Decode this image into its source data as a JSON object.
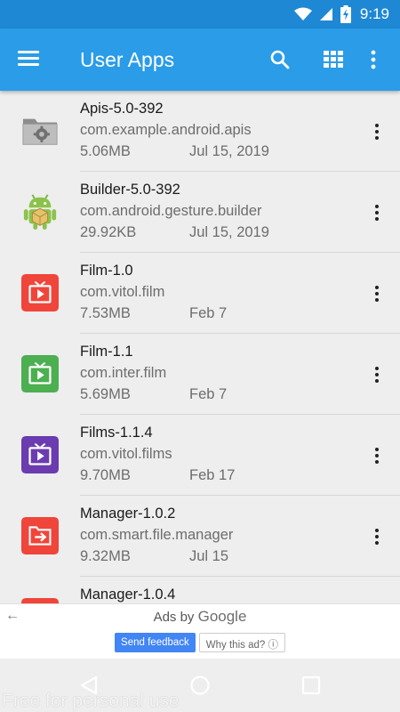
{
  "status_bar": {
    "time": "9:19",
    "icons": [
      "wifi-icon",
      "cellular-signal-icon",
      "battery-charging-icon"
    ]
  },
  "app_bar": {
    "title": "User Apps",
    "icons": [
      "menu-icon",
      "search-icon",
      "grid-view-icon",
      "more-vert-icon"
    ]
  },
  "apps": [
    {
      "name": "Apis-5.0-392",
      "package": "com.example.android.apis",
      "size": "5.06MB",
      "date": "Jul 15, 2019",
      "icon": "folder-gear-icon"
    },
    {
      "name": "Builder-5.0-392",
      "package": "com.android.gesture.builder",
      "size": "29.92KB",
      "date": "Jul 15, 2019",
      "icon": "android-robot-icon"
    },
    {
      "name": "Film-1.0",
      "package": "com.vitol.film",
      "size": "7.53MB",
      "date": "Feb 7",
      "icon": "tv-play-icon",
      "color": "#f0453a"
    },
    {
      "name": "Film-1.1",
      "package": "com.inter.film",
      "size": "5.69MB",
      "date": "Feb 7",
      "icon": "tv-play-icon",
      "color": "#4caf50"
    },
    {
      "name": "Films-1.1.4",
      "package": "com.vitol.films",
      "size": "9.70MB",
      "date": "Feb 17",
      "icon": "tv-play-icon",
      "color": "#6a3cb0"
    },
    {
      "name": "Manager-1.0.2",
      "package": "com.smart.file.manager",
      "size": "9.32MB",
      "date": "Jul 15",
      "icon": "file-transfer-icon",
      "color": "#f0453a"
    },
    {
      "name": "Manager-1.0.4",
      "package": "",
      "size": "",
      "date": "",
      "icon": "file-transfer-icon",
      "color": "#f0453a"
    }
  ],
  "ad": {
    "ads_by": "Ads by",
    "brand": "Google",
    "feedback_label": "Send feedback",
    "why_label": "Why this ad? ⓘ"
  },
  "nav": {
    "buttons": [
      "back-icon",
      "home-icon",
      "recents-icon"
    ]
  },
  "watermark": "Free for personal use",
  "colors": {
    "status_bar": "#1e88d4",
    "app_bar": "#2a9ce8",
    "background": "#eeeeee",
    "feedback_button": "#4285f4"
  }
}
